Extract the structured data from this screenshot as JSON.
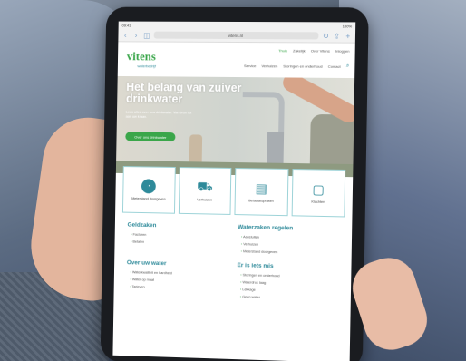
{
  "browser": {
    "time": "09:41",
    "battery": "100%",
    "url": "vitens.nl"
  },
  "site": {
    "logo": "vitens",
    "logo_sub": "waterbedrijf",
    "topnav": [
      "Thuis",
      "Zakelijk",
      "Over Vitens",
      "Inloggen"
    ],
    "mainnav": [
      "Service",
      "Verhuizen",
      "Storingen en onderhoud",
      "Contact"
    ]
  },
  "hero": {
    "title": "Het belang van zuiver drinkwater",
    "text": "Lees alles over ons drinkwater. Van bron tot aan uw kraan.",
    "button": "Over ons drinkwater"
  },
  "tiles": [
    {
      "label": "Meterstand doorgeven",
      "icon": "gauge-icon"
    },
    {
      "label": "Verhuizen",
      "icon": "truck-icon"
    },
    {
      "label": "Betaalafspraken",
      "icon": "document-icon"
    },
    {
      "label": "Klachten",
      "icon": "chat-icon"
    }
  ],
  "sections": [
    {
      "title": "Geldzaken",
      "items": [
        "Facturen",
        "Betalen"
      ]
    },
    {
      "title": "Waterzaken regelen",
      "items": [
        "Aansluiten",
        "Verhuizen",
        "Meterstand doorgeven"
      ]
    },
    {
      "title": "Over uw water",
      "items": [
        "Waterkwaliteit en hardheid",
        "Water op maat",
        "Tarieven"
      ]
    },
    {
      "title": "Er is iets mis",
      "items": [
        "Storingen en onderhoud",
        "Waterdruk laag",
        "Lekkage",
        "Geen water"
      ]
    }
  ],
  "colors": {
    "brand_green": "#3aa64a",
    "brand_teal": "#2e8a9a"
  }
}
